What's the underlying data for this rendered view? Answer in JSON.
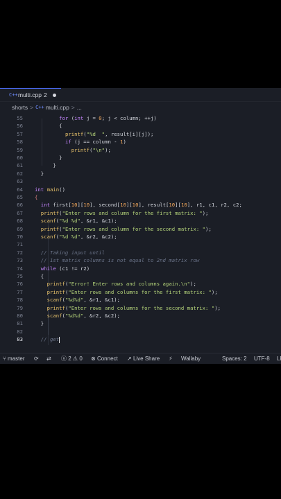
{
  "tab": {
    "icon": "C++",
    "filename": "multi.cpp",
    "badge": "2",
    "modified": true
  },
  "breadcrumb": {
    "folder": "shorts",
    "separator": ">",
    "file_icon": "C++",
    "file": "multi.cpp",
    "tail": "..."
  },
  "code_lines": [
    {
      "n": "55",
      "parts": [
        [
          "p",
          "        "
        ],
        [
          "k",
          "for"
        ],
        [
          "p",
          " ("
        ],
        [
          "k",
          "int"
        ],
        [
          "p",
          " j = "
        ],
        [
          "n",
          "0"
        ],
        [
          "p",
          "; j < column; ++j)"
        ]
      ]
    },
    {
      "n": "56",
      "parts": [
        [
          "p",
          "        {"
        ]
      ]
    },
    {
      "n": "57",
      "parts": [
        [
          "p",
          "          "
        ],
        [
          "f",
          "printf"
        ],
        [
          "p",
          "("
        ],
        [
          "s",
          "\"%d  \""
        ],
        [
          "p",
          ", result[i][j]);"
        ]
      ]
    },
    {
      "n": "58",
      "parts": [
        [
          "p",
          "          "
        ],
        [
          "k",
          "if"
        ],
        [
          "p",
          " (j == column - "
        ],
        [
          "n",
          "1"
        ],
        [
          "p",
          ")"
        ]
      ]
    },
    {
      "n": "59",
      "parts": [
        [
          "p",
          "            "
        ],
        [
          "f",
          "printf"
        ],
        [
          "p",
          "("
        ],
        [
          "s",
          "\"\\n\""
        ],
        [
          "p",
          ");"
        ]
      ]
    },
    {
      "n": "60",
      "parts": [
        [
          "p",
          "        }"
        ]
      ]
    },
    {
      "n": "61",
      "parts": [
        [
          "p",
          "      }"
        ]
      ]
    },
    {
      "n": "62",
      "parts": [
        [
          "p",
          "  }"
        ]
      ]
    },
    {
      "n": "63",
      "parts": [
        [
          "p",
          ""
        ]
      ]
    },
    {
      "n": "64",
      "parts": [
        [
          "k",
          "int"
        ],
        [
          "p",
          " "
        ],
        [
          "f",
          "main"
        ],
        [
          "p",
          "()"
        ]
      ]
    },
    {
      "n": "65",
      "parts": [
        [
          "v",
          "{"
        ]
      ]
    },
    {
      "n": "66",
      "parts": [
        [
          "p",
          "  "
        ],
        [
          "k",
          "int"
        ],
        [
          "p",
          " first["
        ],
        [
          "n",
          "10"
        ],
        [
          "p",
          "]["
        ],
        [
          "n",
          "10"
        ],
        [
          "p",
          "], second["
        ],
        [
          "n",
          "10"
        ],
        [
          "p",
          "]["
        ],
        [
          "n",
          "10"
        ],
        [
          "p",
          "], result["
        ],
        [
          "n",
          "10"
        ],
        [
          "p",
          "]["
        ],
        [
          "n",
          "10"
        ],
        [
          "p",
          "], r1, c1, r2, c2;"
        ]
      ]
    },
    {
      "n": "67",
      "parts": [
        [
          "p",
          "  "
        ],
        [
          "f",
          "printf"
        ],
        [
          "p",
          "("
        ],
        [
          "s",
          "\"Enter rows and column for the first matrix: \""
        ],
        [
          "p",
          ");"
        ]
      ]
    },
    {
      "n": "68",
      "parts": [
        [
          "p",
          "  "
        ],
        [
          "f",
          "scanf"
        ],
        [
          "p",
          "("
        ],
        [
          "s",
          "\"%d %d\""
        ],
        [
          "p",
          ", &r1, &c1);"
        ]
      ]
    },
    {
      "n": "69",
      "parts": [
        [
          "p",
          "  "
        ],
        [
          "f",
          "printf"
        ],
        [
          "p",
          "("
        ],
        [
          "s",
          "\"Enter rows and column for the second matrix: \""
        ],
        [
          "p",
          ");"
        ]
      ]
    },
    {
      "n": "70",
      "parts": [
        [
          "p",
          "  "
        ],
        [
          "f",
          "scanf"
        ],
        [
          "p",
          "("
        ],
        [
          "s",
          "\"%d %d\""
        ],
        [
          "p",
          ", &r2, &c2);"
        ]
      ]
    },
    {
      "n": "71",
      "parts": [
        [
          "p",
          ""
        ]
      ]
    },
    {
      "n": "72",
      "parts": [
        [
          "c",
          "  // Taking input until"
        ]
      ]
    },
    {
      "n": "73",
      "parts": [
        [
          "c",
          "  // 1st matrix columns is not equal to 2nd matrix row"
        ]
      ]
    },
    {
      "n": "74",
      "parts": [
        [
          "p",
          "  "
        ],
        [
          "k",
          "while"
        ],
        [
          "p",
          " (c1 != r2)"
        ]
      ]
    },
    {
      "n": "75",
      "parts": [
        [
          "p",
          "  {"
        ]
      ]
    },
    {
      "n": "76",
      "parts": [
        [
          "p",
          "    "
        ],
        [
          "f",
          "printf"
        ],
        [
          "p",
          "("
        ],
        [
          "s",
          "\"Error! Enter rows and columns again.\\n\""
        ],
        [
          "p",
          ");"
        ]
      ]
    },
    {
      "n": "77",
      "parts": [
        [
          "p",
          "    "
        ],
        [
          "f",
          "printf"
        ],
        [
          "p",
          "("
        ],
        [
          "s",
          "\"Enter rows and columns for the first matrix: \""
        ],
        [
          "p",
          ");"
        ]
      ]
    },
    {
      "n": "78",
      "parts": [
        [
          "p",
          "    "
        ],
        [
          "f",
          "scanf"
        ],
        [
          "p",
          "("
        ],
        [
          "s",
          "\"%d%d\""
        ],
        [
          "p",
          ", &r1, &c1);"
        ]
      ]
    },
    {
      "n": "79",
      "parts": [
        [
          "p",
          "    "
        ],
        [
          "f",
          "printf"
        ],
        [
          "p",
          "("
        ],
        [
          "s",
          "\"Enter rows and columns for the second matrix: \""
        ],
        [
          "p",
          ");"
        ]
      ]
    },
    {
      "n": "80",
      "parts": [
        [
          "p",
          "    "
        ],
        [
          "f",
          "scanf"
        ],
        [
          "p",
          "("
        ],
        [
          "s",
          "\"%d%d\""
        ],
        [
          "p",
          ", &r2, &c2);"
        ]
      ]
    },
    {
      "n": "81",
      "parts": [
        [
          "p",
          "  }"
        ]
      ]
    },
    {
      "n": "82",
      "parts": [
        [
          "p",
          ""
        ]
      ]
    },
    {
      "n": "83",
      "parts": [
        [
          "c",
          "  // get"
        ]
      ]
    }
  ],
  "active_line": "83",
  "status": {
    "branch": "master",
    "errors": "2",
    "warnings": "0",
    "connect": "Connect",
    "live_share": "Live Share",
    "wallaby": "Wallaby",
    "spaces": "Spaces: 2",
    "encoding": "UTF-8",
    "eol": "LF"
  },
  "colors": {
    "editor_bg": "#1b1e26",
    "keyword": "#c586ff",
    "function": "#e8c26a",
    "string": "#b5d47a",
    "number": "#f1a65a",
    "comment": "#6a7388"
  }
}
